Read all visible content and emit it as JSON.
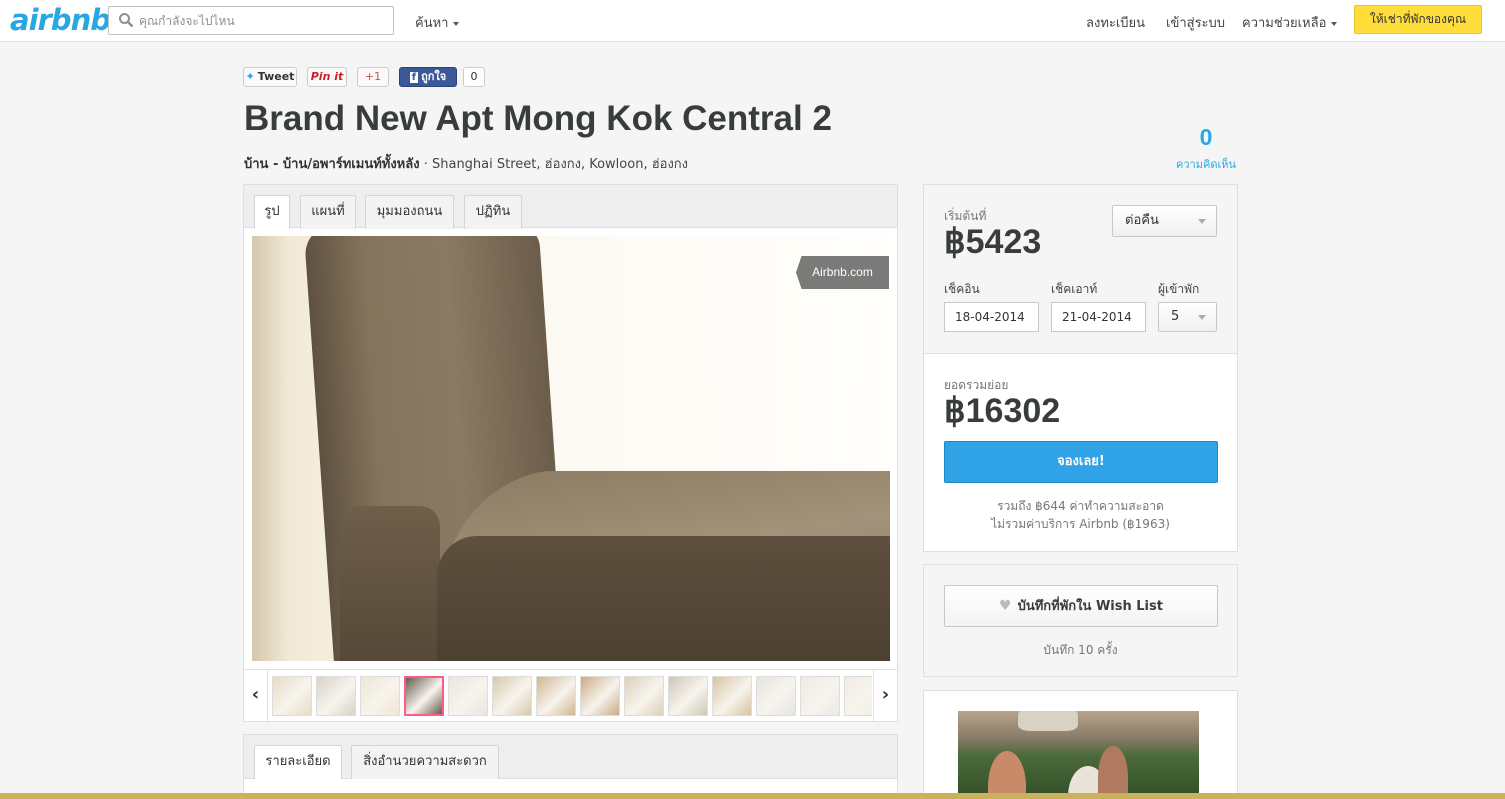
{
  "header": {
    "logo": "airbnb",
    "search_placeholder": "คุณกำลังจะไปไหน",
    "nav_search": "ค้นหา",
    "nav_signup": "ลงทะเบียน",
    "nav_login": "เข้าสู่ระบบ",
    "nav_help": "ความช่วยเหลือ",
    "host_button": "ให้เช่าที่พักของคุณ"
  },
  "share": {
    "tweet": "Tweet",
    "pin": "Pin it",
    "gplus": "+1",
    "fb_like": "ถูกใจ",
    "fb_count": "0"
  },
  "listing": {
    "title": "Brand New Apt Mong Kok Central 2",
    "type": "บ้าน - บ้าน/อพาร์ทเมนท์ทั้งหลัง",
    "location": "· Shanghai Street, ฮ่องกง, Kowloon, ฮ่องกง",
    "reviews_count": "0",
    "reviews_label": "ความคิดเห็น"
  },
  "gallery": {
    "tabs": [
      "รูป",
      "แผนที่",
      "มุมมองถนน",
      "ปฏิทิน"
    ],
    "watermark": "Airbnb.com",
    "prev": "‹",
    "next": "›",
    "thumb_count": 14,
    "active_thumb": 3
  },
  "details": {
    "tabs": [
      "รายละเอียด",
      "สิ่งอำนวยความสะดวก"
    ]
  },
  "booking": {
    "from_label": "เริ่มต้นที่",
    "price": "฿5423",
    "period": "ต่อคืน",
    "checkin_label": "เช็คอิน",
    "checkout_label": "เช็คเอาท์",
    "guests_label": "ผู้เข้าพัก",
    "checkin": "18-04-2014",
    "checkout": "21-04-2014",
    "guests": "5",
    "subtotal_label": "ยอดรวมย่อย",
    "subtotal": "฿16302",
    "book_button": "จองเลย!",
    "cleaning_note": "รวมถึง ฿644 ค่าทำความสะอาด",
    "service_note": "ไม่รวมค่าบริการ Airbnb (฿1963)"
  },
  "wishlist": {
    "button": "บันทึกที่พักใน Wish List",
    "saved": "บันทึก 10 ครั้ง"
  },
  "colors": {
    "brand": "#27a8e2",
    "book_button": "#2fa3e6",
    "host_button": "#ffde3b"
  }
}
